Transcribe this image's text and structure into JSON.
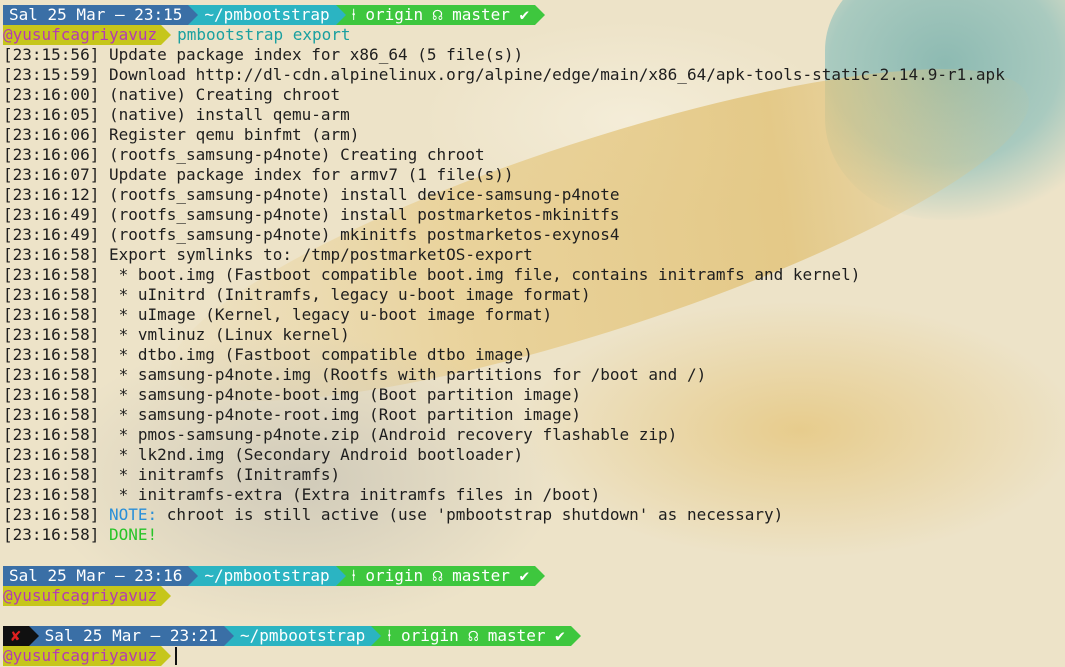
{
  "prompts": [
    {
      "date": "Sal 25 Mar – 23:15",
      "path": "~/pmbootstrap",
      "branch_icon": "⍿",
      "git": "origin ☊ master ✔",
      "user": "@yusufcagriyavuz",
      "command": "pmbootstrap export"
    },
    {
      "date": "Sal 25 Mar – 23:16",
      "path": "~/pmbootstrap",
      "branch_icon": "⍿",
      "git": "origin ☊ master ✔",
      "user": "@yusufcagriyavuz",
      "command": ""
    },
    {
      "error_mark": "✘",
      "date": "Sal 25 Mar – 23:21",
      "path": "~/pmbootstrap",
      "branch_icon": "⍿",
      "git": "origin ☊ master ✔",
      "user": "@yusufcagriyavuz",
      "command": ""
    }
  ],
  "log": [
    {
      "ts": "[23:15:56]",
      "msg": "Update package index for x86_64 (5 file(s))"
    },
    {
      "ts": "[23:15:59]",
      "msg": "Download http://dl-cdn.alpinelinux.org/alpine/edge/main/x86_64/apk-tools-static-2.14.9-r1.apk"
    },
    {
      "ts": "[23:16:00]",
      "msg": "(native) Creating chroot"
    },
    {
      "ts": "[23:16:05]",
      "msg": "(native) install qemu-arm"
    },
    {
      "ts": "[23:16:06]",
      "msg": "Register qemu binfmt (arm)"
    },
    {
      "ts": "[23:16:06]",
      "msg": "(rootfs_samsung-p4note) Creating chroot"
    },
    {
      "ts": "[23:16:07]",
      "msg": "Update package index for armv7 (1 file(s))"
    },
    {
      "ts": "[23:16:12]",
      "msg": "(rootfs_samsung-p4note) install device-samsung-p4note"
    },
    {
      "ts": "[23:16:49]",
      "msg": "(rootfs_samsung-p4note) install postmarketos-mkinitfs"
    },
    {
      "ts": "[23:16:49]",
      "msg": "(rootfs_samsung-p4note) mkinitfs postmarketos-exynos4"
    },
    {
      "ts": "[23:16:58]",
      "msg": "Export symlinks to: /tmp/postmarketOS-export"
    },
    {
      "ts": "[23:16:58]",
      "msg": " * boot.img (Fastboot compatible boot.img file, contains initramfs and kernel)"
    },
    {
      "ts": "[23:16:58]",
      "msg": " * uInitrd (Initramfs, legacy u-boot image format)"
    },
    {
      "ts": "[23:16:58]",
      "msg": " * uImage (Kernel, legacy u-boot image format)"
    },
    {
      "ts": "[23:16:58]",
      "msg": " * vmlinuz (Linux kernel)"
    },
    {
      "ts": "[23:16:58]",
      "msg": " * dtbo.img (Fastboot compatible dtbo image)"
    },
    {
      "ts": "[23:16:58]",
      "msg": " * samsung-p4note.img (Rootfs with partitions for /boot and /)"
    },
    {
      "ts": "[23:16:58]",
      "msg": " * samsung-p4note-boot.img (Boot partition image)"
    },
    {
      "ts": "[23:16:58]",
      "msg": " * samsung-p4note-root.img (Root partition image)"
    },
    {
      "ts": "[23:16:58]",
      "msg": " * pmos-samsung-p4note.zip (Android recovery flashable zip)"
    },
    {
      "ts": "[23:16:58]",
      "msg": " * lk2nd.img (Secondary Android bootloader)"
    },
    {
      "ts": "[23:16:58]",
      "msg": " * initramfs (Initramfs)"
    },
    {
      "ts": "[23:16:58]",
      "msg": " * initramfs-extra (Extra initramfs files in /boot)"
    }
  ],
  "note": {
    "ts": "[23:16:58]",
    "label": "NOTE:",
    "msg": " chroot is still active (use 'pmbootstrap shutdown' as necessary)"
  },
  "done": {
    "ts": "[23:16:58]",
    "label": "DONE!"
  },
  "colors": {
    "date_segment": "#3a6fa6",
    "path_segment": "#2bb4c2",
    "git_segment": "#3ec73e",
    "user_segment": "#c6c61b",
    "user_text": "#b43ab4",
    "command_text": "#1aa0a0",
    "note_text": "#2a8fd8",
    "done_text": "#28c428",
    "error_mark": "#e02020"
  }
}
